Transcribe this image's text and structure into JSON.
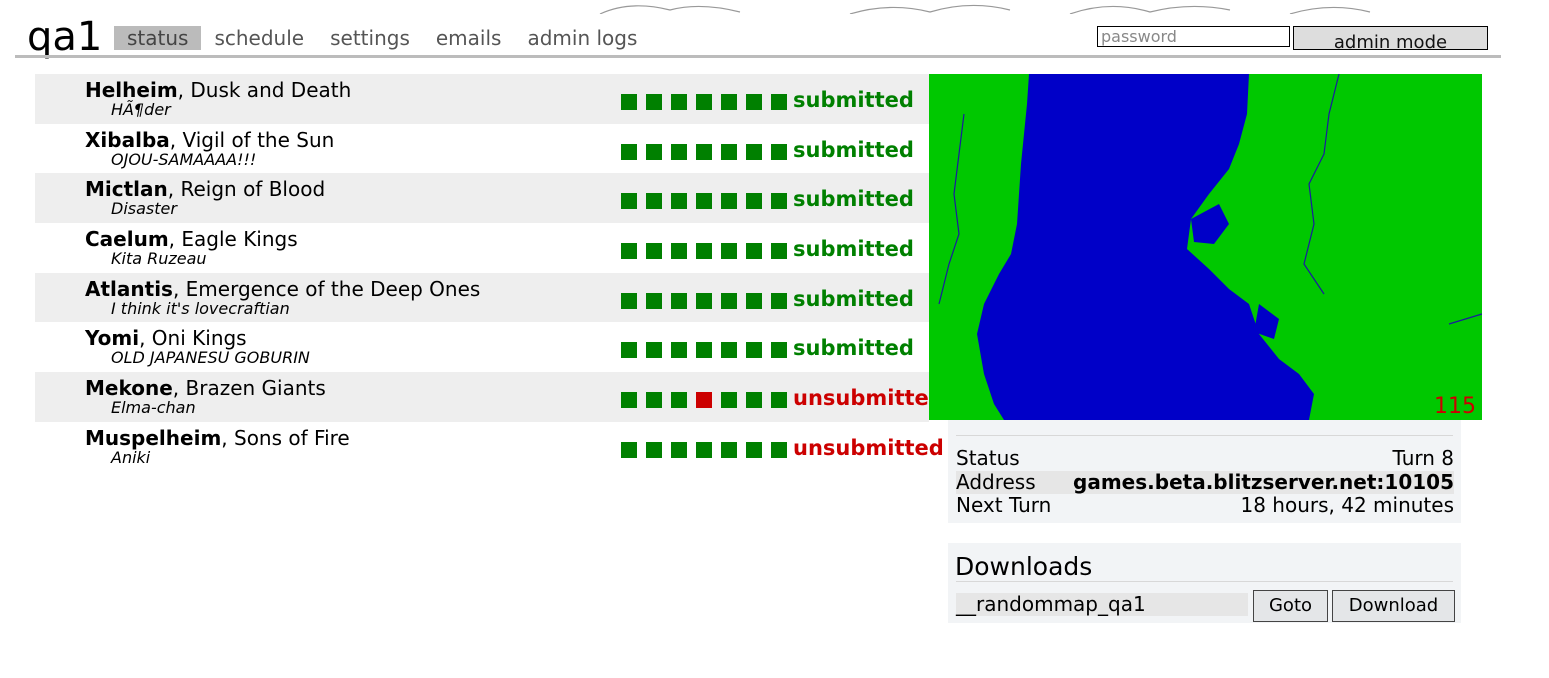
{
  "header": {
    "title": "qa1",
    "tabs": [
      {
        "label": "status"
      },
      {
        "label": "schedule"
      },
      {
        "label": "settings"
      },
      {
        "label": "emails"
      },
      {
        "label": "admin logs"
      }
    ],
    "password_placeholder": "password",
    "admin_button": "admin mode"
  },
  "players": [
    {
      "nation": "Helheim",
      "epithet": ", Dusk and Death",
      "player": "HÃ¶der",
      "turns": [
        "ok",
        "ok",
        "ok",
        "ok",
        "ok",
        "ok",
        "ok"
      ],
      "status": "submitted",
      "status_color": "#008000"
    },
    {
      "nation": "Xibalba",
      "epithet": ", Vigil of the Sun",
      "player": "OJOU-SAMAAAA!!!",
      "turns": [
        "ok",
        "ok",
        "ok",
        "ok",
        "ok",
        "ok",
        "ok"
      ],
      "status": "submitted",
      "status_color": "#008000"
    },
    {
      "nation": "Mictlan",
      "epithet": ", Reign of Blood",
      "player": "Disaster",
      "turns": [
        "ok",
        "ok",
        "ok",
        "ok",
        "ok",
        "ok",
        "ok"
      ],
      "status": "submitted",
      "status_color": "#008000"
    },
    {
      "nation": "Caelum",
      "epithet": ", Eagle Kings",
      "player": "Kita Ruzeau",
      "turns": [
        "ok",
        "ok",
        "ok",
        "ok",
        "ok",
        "ok",
        "ok"
      ],
      "status": "submitted",
      "status_color": "#008000"
    },
    {
      "nation": "Atlantis",
      "epithet": ", Emergence of the Deep Ones",
      "player": "I think it's lovecraftian",
      "turns": [
        "ok",
        "ok",
        "ok",
        "ok",
        "ok",
        "ok",
        "ok"
      ],
      "status": "submitted",
      "status_color": "#008000"
    },
    {
      "nation": "Yomi",
      "epithet": ", Oni Kings",
      "player": "OLD JAPANESU GOBURIN",
      "turns": [
        "ok",
        "ok",
        "ok",
        "ok",
        "ok",
        "ok",
        "ok"
      ],
      "status": "submitted",
      "status_color": "#008000"
    },
    {
      "nation": "Mekone",
      "epithet": ", Brazen Giants",
      "player": "Elma-chan",
      "turns": [
        "ok",
        "ok",
        "ok",
        "missed",
        "ok",
        "ok",
        "ok"
      ],
      "status": "unsubmitted",
      "status_color": "#cc0000"
    },
    {
      "nation": "Muspelheim",
      "epithet": ", Sons of Fire",
      "player": "Aniki",
      "turns": [
        "ok",
        "ok",
        "ok",
        "ok",
        "ok",
        "ok",
        "ok"
      ],
      "status": "unsubmitted",
      "status_color": "#cc0000"
    }
  ],
  "map": {
    "number": "115",
    "land_color": "#00c800",
    "sea_color": "#0000c8"
  },
  "status_table": {
    "rows": [
      {
        "key": "Status",
        "value": "Turn 8"
      },
      {
        "key": "Address",
        "value": "games.beta.blitzserver.net:10105"
      },
      {
        "key": "Next Turn",
        "value": "18 hours, 42 minutes"
      }
    ]
  },
  "downloads": {
    "heading": "Downloads",
    "file": "__randommap_qa1",
    "goto_label": "Goto",
    "download_label": "Download"
  }
}
